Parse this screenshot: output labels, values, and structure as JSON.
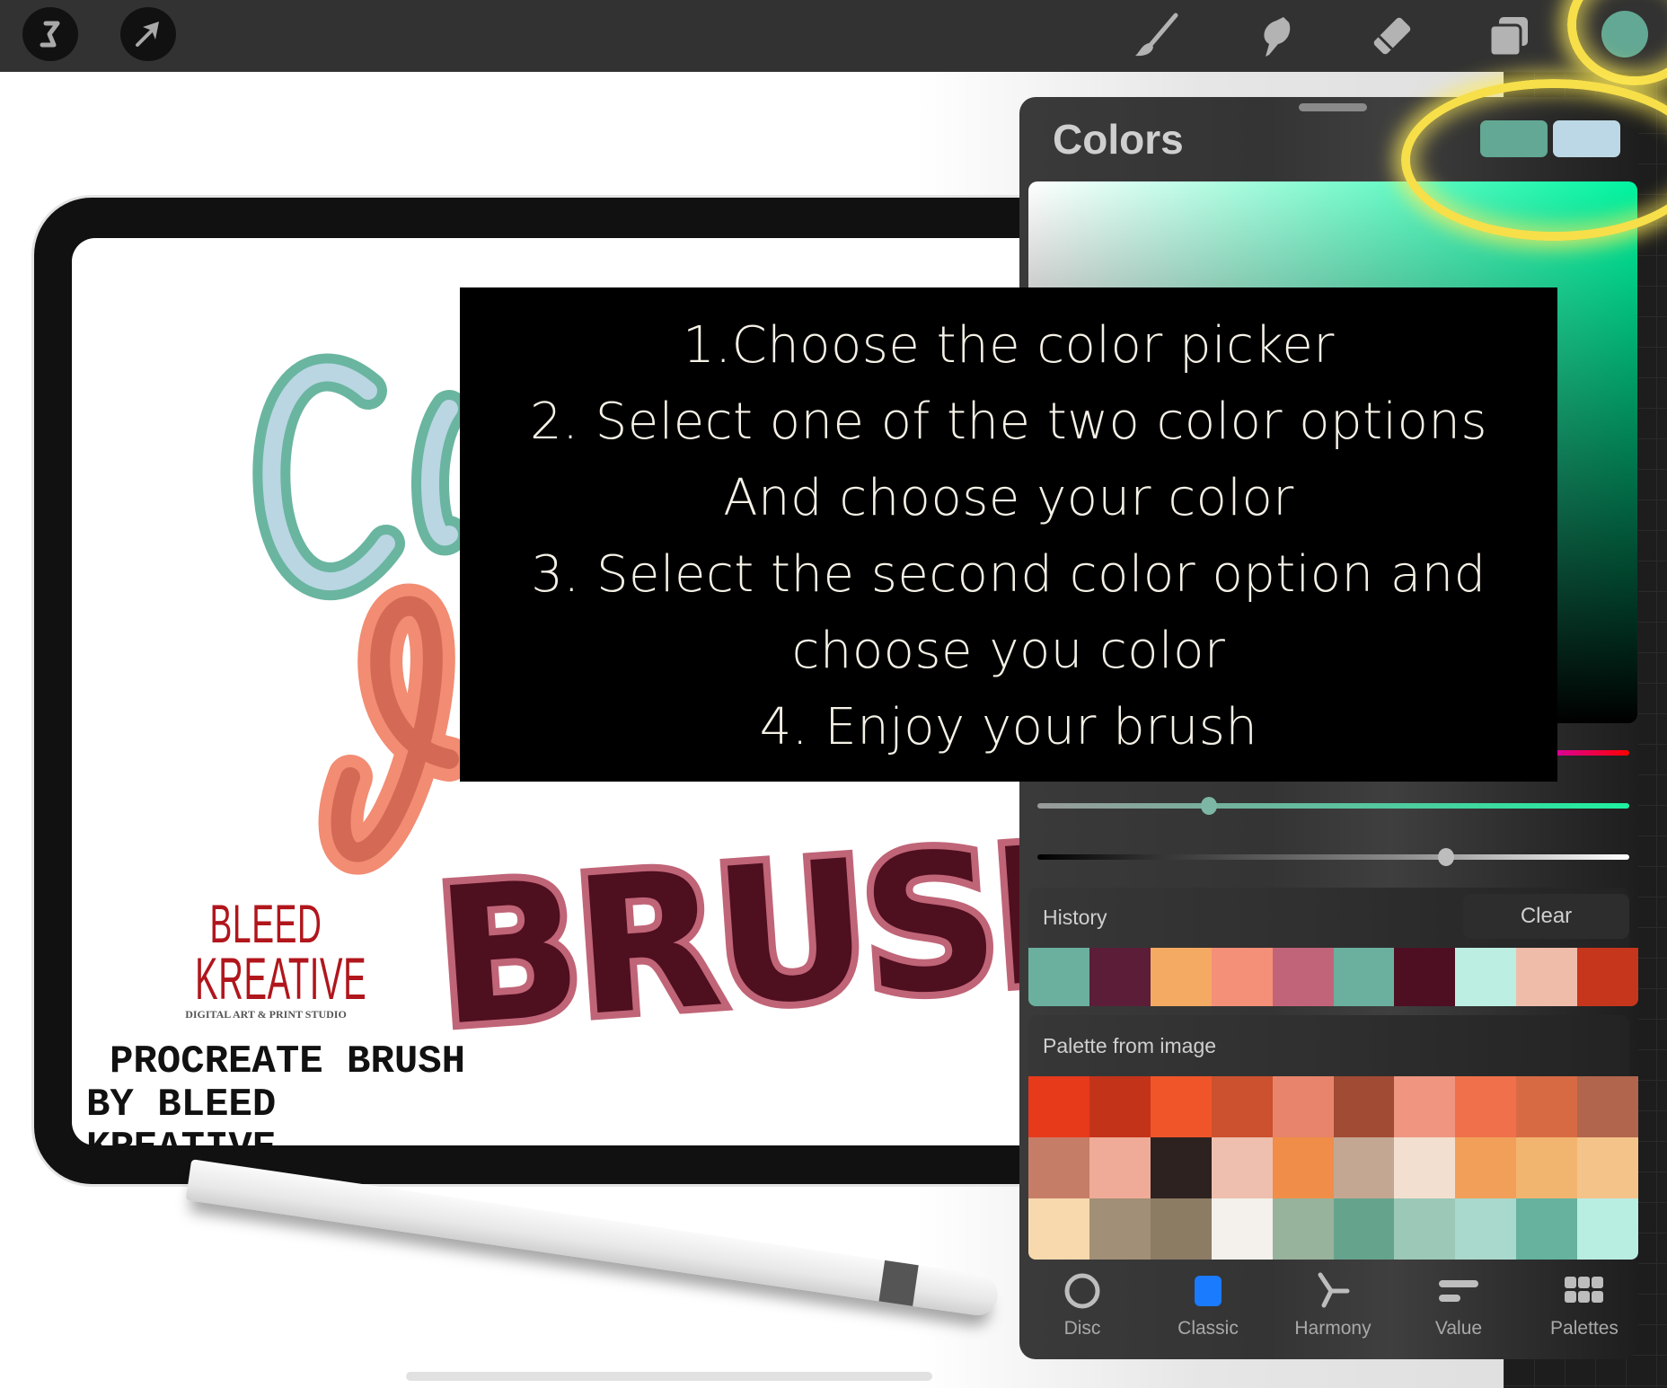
{
  "toolbar": {
    "left_tools": [
      {
        "name": "adjustments",
        "icon": "adjustments-icon"
      },
      {
        "name": "selection",
        "icon": "selection-arrow-icon"
      }
    ],
    "right_tools": [
      {
        "name": "brush",
        "icon": "brush-icon"
      },
      {
        "name": "smudge",
        "icon": "smudge-icon"
      },
      {
        "name": "eraser",
        "icon": "eraser-icon"
      },
      {
        "name": "layers",
        "icon": "layers-icon"
      },
      {
        "name": "color",
        "icon": "color-dot-icon",
        "color": "#62a894"
      }
    ]
  },
  "canvas": {
    "artwork_title_parts": [
      "CO",
      "LOR",
      "BRUSH"
    ],
    "brand_line1": "BLEED",
    "brand_line2": "KREATIVE",
    "brand_tagline": "DIGITAL ART & PRINT STUDIO",
    "caption_line1": "PROCREATE BRUSH",
    "caption_line2": "BY BLEED KREATIVE",
    "colors": {
      "teal": "#6ab5a0",
      "light_blue": "#b9d6e2",
      "coral": "#f28c73",
      "coral_dark": "#d46a55",
      "rose": "#c06477",
      "maroon": "#4e0f1f",
      "brand_red": "#b0161c"
    }
  },
  "colors_panel": {
    "title": "Colors",
    "primary_swatch": "#62a894",
    "secondary_swatch": "#bcd8e6",
    "sliders": {
      "hue": 0.99,
      "saturation": 0.29,
      "brightness": 0.69
    },
    "history": {
      "label": "History",
      "clear_label": "Clear",
      "swatches": [
        "#6bb09e",
        "#5c1d39",
        "#f4aa62",
        "#f48f78",
        "#c26479",
        "#6bb09e",
        "#4f0f22",
        "#bceee2",
        "#efbcaa",
        "#c6361c"
      ]
    },
    "palette": {
      "label": "Palette from image",
      "rows": [
        [
          "#e73a1b",
          "#c3331a",
          "#f0552a",
          "#cc512e",
          "#e8846b",
          "#a24b34",
          "#ef9580",
          "#f0704c",
          "#d86a43",
          "#b1654d"
        ],
        [
          "#c67d68",
          "#efab97",
          "#2e2220",
          "#eebfae",
          "#f08d48",
          "#c4a792",
          "#f3dfcf",
          "#f29f5a",
          "#f2b570",
          "#f4c389"
        ],
        [
          "#f8d9ad",
          "#a28f77",
          "#8c7c64",
          "#f4f1ec",
          "#98b39b",
          "#66a38c",
          "#9cc8b7",
          "#a9d8cc",
          "#66b29e",
          "#b8ede1"
        ]
      ]
    },
    "tabs": [
      {
        "label": "Disc",
        "icon": "disc-icon",
        "active": false
      },
      {
        "label": "Classic",
        "icon": "classic-icon",
        "active": true
      },
      {
        "label": "Harmony",
        "icon": "harmony-icon",
        "active": false
      },
      {
        "label": "Value",
        "icon": "value-icon",
        "active": false
      },
      {
        "label": "Palettes",
        "icon": "palettes-icon",
        "active": false
      }
    ],
    "accent": "#1a7bff"
  },
  "instructions": {
    "lines": [
      "1.Choose the color picker",
      "2. Select one of the two color options",
      "And choose your color",
      "3. Select the second color option and",
      "choose you color",
      "4. Enjoy your brush"
    ]
  },
  "highlight_color": "#f7df4a"
}
